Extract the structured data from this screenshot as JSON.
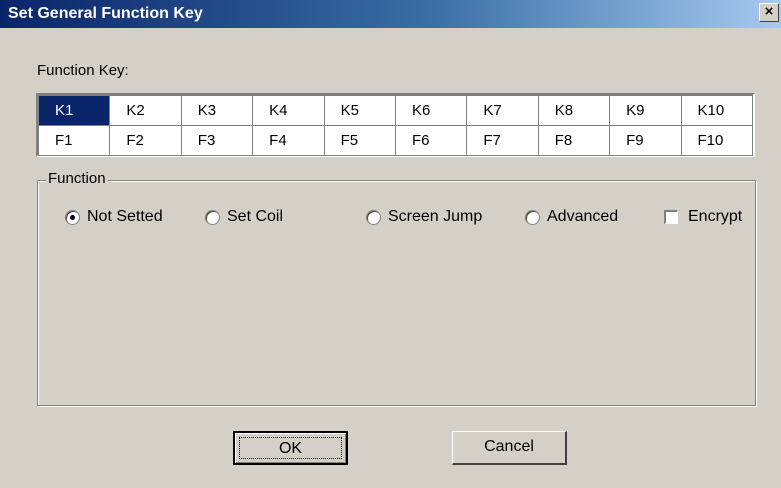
{
  "window": {
    "title": "Set General Function Key",
    "close_glyph": "×"
  },
  "function_key": {
    "label": "Function Key:",
    "rows": [
      [
        "K1",
        "K2",
        "K3",
        "K4",
        "K5",
        "K6",
        "K7",
        "K8",
        "K9",
        "K10"
      ],
      [
        "F1",
        "F2",
        "F3",
        "F4",
        "F5",
        "F6",
        "F7",
        "F8",
        "F9",
        "F10"
      ]
    ],
    "selected": "K1"
  },
  "function_group": {
    "legend": "Function",
    "options": [
      {
        "label": "Not Setted",
        "checked": true
      },
      {
        "label": "Set Coil",
        "checked": false
      },
      {
        "label": "Screen Jump",
        "checked": false
      },
      {
        "label": "Advanced",
        "checked": false
      }
    ],
    "encrypt": {
      "label": "Encrypt",
      "checked": false
    }
  },
  "buttons": {
    "ok": "OK",
    "cancel": "Cancel"
  }
}
